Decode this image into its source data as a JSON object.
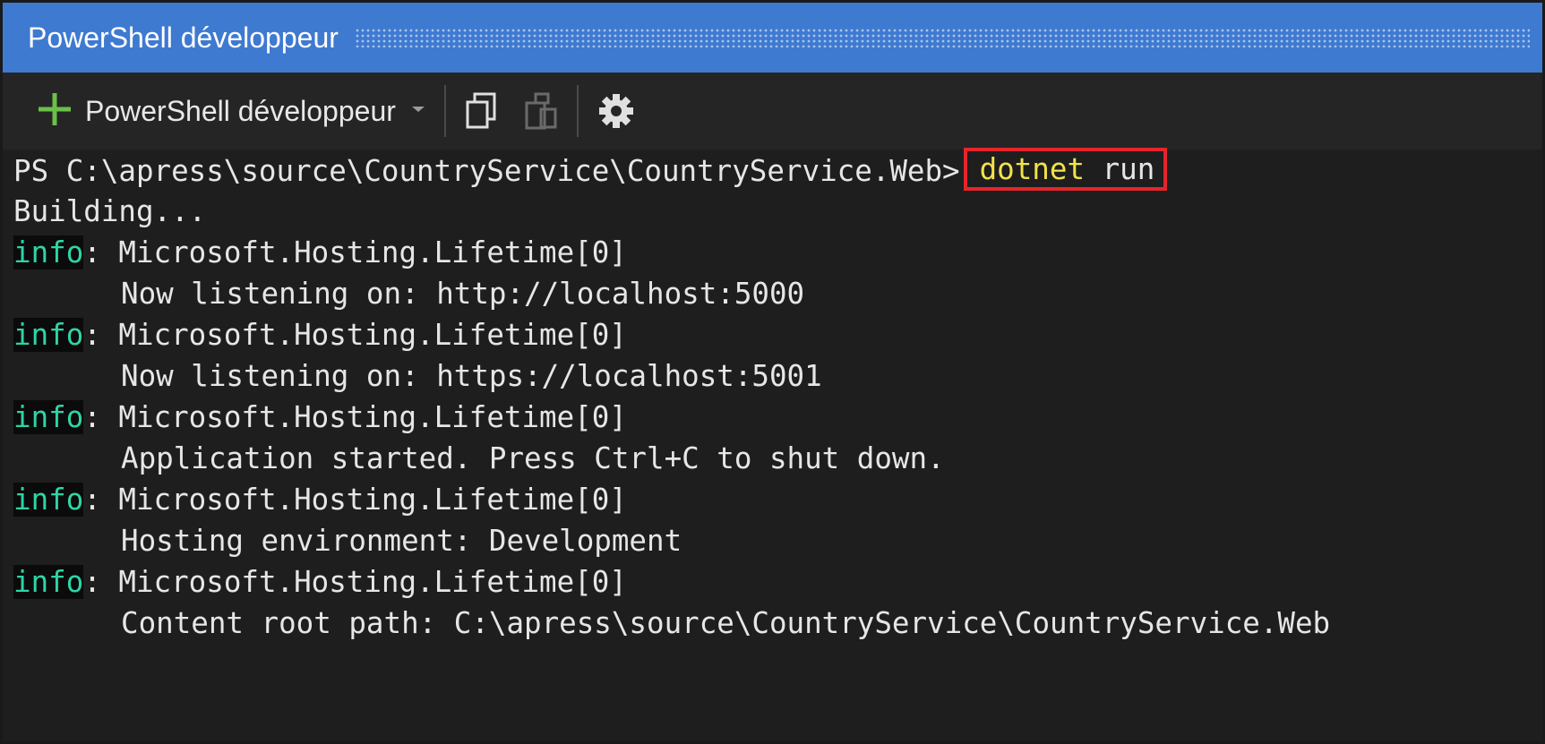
{
  "window": {
    "title": "PowerShell développeur"
  },
  "toolbar": {
    "new_terminal_label": "PowerShell développeur",
    "icons": [
      "plus-icon",
      "chevron-down-icon",
      "copy-icon",
      "paste-icon",
      "gear-icon"
    ]
  },
  "terminal": {
    "prompt": "PS C:\\apress\\source\\CountryService\\CountryService.Web>",
    "command_keyword": "dotnet",
    "command_arg": " run",
    "lines": [
      "Building...",
      "info",
      ": Microsoft.Hosting.Lifetime[0]",
      "Now listening on: http://localhost:5000",
      "Now listening on: https://localhost:5001",
      "Application started. Press Ctrl+C to shut down.",
      "Hosting environment: Development",
      "Content root path: C:\\apress\\source\\CountryService\\CountryService.Web"
    ]
  },
  "colors": {
    "title_bar": "#3f7ad1",
    "info_text": "#2fd4a6",
    "command_keyword": "#f2e24a",
    "highlight_border": "#e5252a"
  }
}
